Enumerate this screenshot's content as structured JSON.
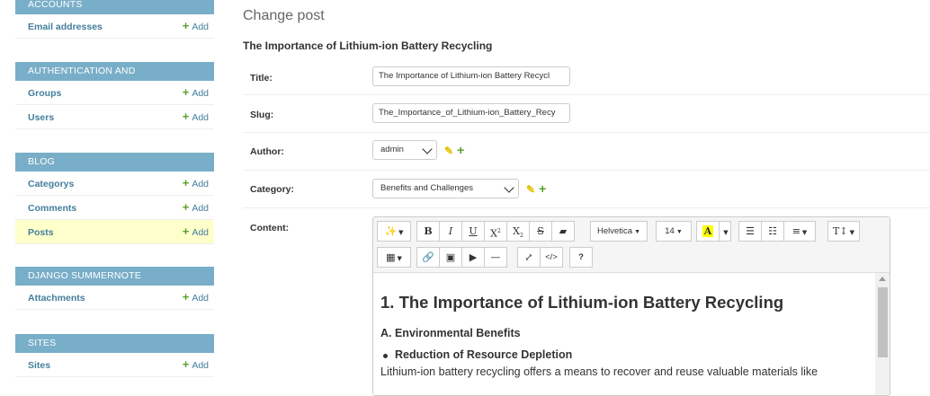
{
  "sidebar": {
    "modules": [
      {
        "header": "Accounts",
        "items": [
          {
            "label": "Email addresses",
            "add": "Add"
          }
        ]
      },
      {
        "header": "Authentication and Authorization",
        "items": [
          {
            "label": "Groups",
            "add": "Add"
          },
          {
            "label": "Users",
            "add": "Add"
          }
        ]
      },
      {
        "header": "Blog",
        "items": [
          {
            "label": "Categorys",
            "add": "Add"
          },
          {
            "label": "Comments",
            "add": "Add"
          },
          {
            "label": "Posts",
            "add": "Add"
          }
        ]
      },
      {
        "header": "Django Summernote",
        "items": [
          {
            "label": "Attachments",
            "add": "Add"
          }
        ]
      },
      {
        "header": "Sites",
        "items": [
          {
            "label": "Sites",
            "add": "Add"
          }
        ]
      }
    ]
  },
  "main": {
    "page_title": "Change post",
    "object_title": "The Importance of Lithium-ion Battery Recycling",
    "fields": {
      "title": {
        "label": "Title:",
        "value": "The Importance of Lithium-ion Battery Recycl"
      },
      "slug": {
        "label": "Slug:",
        "value": "The_Importance_of_Lithium-ion_Battery_Recy"
      },
      "author": {
        "label": "Author:",
        "value": "admin"
      },
      "category": {
        "label": "Category:",
        "value": "Benefits and Challenges"
      },
      "content": {
        "label": "Content:"
      }
    },
    "toolbar": {
      "font_name": "Helvetica",
      "font_size": "14",
      "buttons": [
        "magic-icon",
        "bold-icon",
        "italic-icon",
        "underline-icon",
        "superscript-icon",
        "subscript-icon",
        "strikethrough-icon",
        "eraser-icon",
        "color-icon",
        "ul-icon",
        "ol-icon",
        "align-icon",
        "line-height-icon",
        "table-icon",
        "link-icon",
        "picture-icon",
        "video-icon",
        "hr-icon",
        "fullscreen-icon",
        "code-icon",
        "help-icon"
      ]
    },
    "editor": {
      "h1": "1. The Importance of Lithium-ion Battery Recycling",
      "h2": "A. Environmental Benefits",
      "bullet": "Reduction of Resource Depletion",
      "para": "Lithium-ion battery recycling offers a means to recover and reuse valuable materials like"
    }
  }
}
